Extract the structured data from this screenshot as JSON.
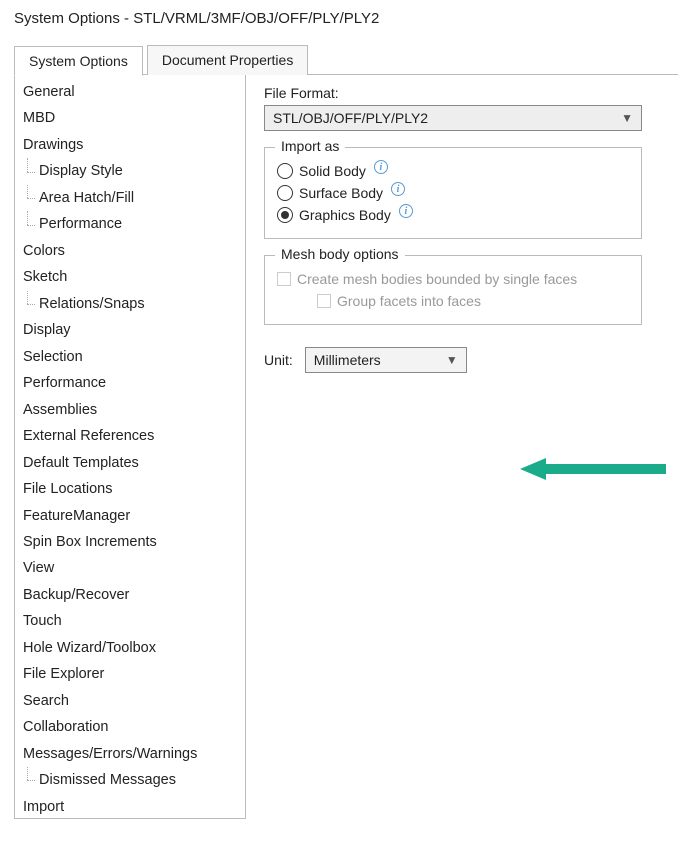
{
  "window": {
    "title": "System Options - STL/VRML/3MF/OBJ/OFF/PLY/PLY2"
  },
  "tabs": {
    "system_options": "System Options",
    "document_properties": "Document Properties"
  },
  "sidebar": {
    "items": [
      {
        "label": "General",
        "child": false
      },
      {
        "label": "MBD",
        "child": false
      },
      {
        "label": "Drawings",
        "child": false
      },
      {
        "label": "Display Style",
        "child": true
      },
      {
        "label": "Area Hatch/Fill",
        "child": true
      },
      {
        "label": "Performance",
        "child": true
      },
      {
        "label": "Colors",
        "child": false
      },
      {
        "label": "Sketch",
        "child": false
      },
      {
        "label": "Relations/Snaps",
        "child": true
      },
      {
        "label": "Display",
        "child": false
      },
      {
        "label": "Selection",
        "child": false
      },
      {
        "label": "Performance",
        "child": false
      },
      {
        "label": "Assemblies",
        "child": false
      },
      {
        "label": "External References",
        "child": false
      },
      {
        "label": "Default Templates",
        "child": false
      },
      {
        "label": "File Locations",
        "child": false
      },
      {
        "label": "FeatureManager",
        "child": false
      },
      {
        "label": "Spin Box Increments",
        "child": false
      },
      {
        "label": "View",
        "child": false
      },
      {
        "label": "Backup/Recover",
        "child": false
      },
      {
        "label": "Touch",
        "child": false
      },
      {
        "label": "Hole Wizard/Toolbox",
        "child": false
      },
      {
        "label": "File Explorer",
        "child": false
      },
      {
        "label": "Search",
        "child": false
      },
      {
        "label": "Collaboration",
        "child": false
      },
      {
        "label": "Messages/Errors/Warnings",
        "child": false
      },
      {
        "label": "Dismissed Messages",
        "child": true
      },
      {
        "label": "Import",
        "child": false
      }
    ]
  },
  "main": {
    "file_format_label": "File Format:",
    "file_format_value": "STL/OBJ/OFF/PLY/PLY2",
    "import_as": {
      "legend": "Import as",
      "solid": "Solid Body",
      "surface": "Surface Body",
      "graphics": "Graphics Body",
      "selected": "graphics"
    },
    "mesh": {
      "legend": "Mesh body options",
      "create": "Create mesh bodies bounded by single faces",
      "group": "Group facets into faces"
    },
    "unit_label": "Unit:",
    "unit_value": "Millimeters"
  }
}
